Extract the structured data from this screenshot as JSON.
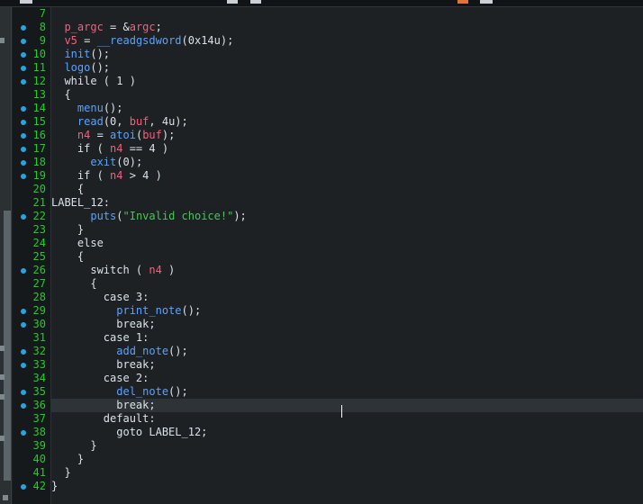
{
  "editor": {
    "lines": [
      {
        "n": "7",
        "bp": false,
        "code": ""
      },
      {
        "n": "8",
        "bp": true,
        "code": "  p_argc = &argc;"
      },
      {
        "n": "9",
        "bp": true,
        "code": "  v5 = __readgsdword(0x14u);"
      },
      {
        "n": "10",
        "bp": true,
        "code": "  init();"
      },
      {
        "n": "11",
        "bp": true,
        "code": "  logo();"
      },
      {
        "n": "12",
        "bp": true,
        "code": "  while ( 1 )"
      },
      {
        "n": "13",
        "bp": false,
        "code": "  {"
      },
      {
        "n": "14",
        "bp": true,
        "code": "    menu();"
      },
      {
        "n": "15",
        "bp": true,
        "code": "    read(0, buf, 4u);"
      },
      {
        "n": "16",
        "bp": true,
        "code": "    n4 = atoi(buf);"
      },
      {
        "n": "17",
        "bp": true,
        "code": "    if ( n4 == 4 )"
      },
      {
        "n": "18",
        "bp": true,
        "code": "      exit(0);"
      },
      {
        "n": "19",
        "bp": true,
        "code": "    if ( n4 > 4 )"
      },
      {
        "n": "20",
        "bp": false,
        "code": "    {"
      },
      {
        "n": "21",
        "bp": false,
        "code": "LABEL_12:"
      },
      {
        "n": "22",
        "bp": true,
        "code": "      puts(\"Invalid choice!\");"
      },
      {
        "n": "23",
        "bp": false,
        "code": "    }"
      },
      {
        "n": "24",
        "bp": false,
        "code": "    else"
      },
      {
        "n": "25",
        "bp": false,
        "code": "    {"
      },
      {
        "n": "26",
        "bp": true,
        "code": "      switch ( n4 )"
      },
      {
        "n": "27",
        "bp": false,
        "code": "      {"
      },
      {
        "n": "28",
        "bp": false,
        "code": "        case 3:"
      },
      {
        "n": "29",
        "bp": true,
        "code": "          print_note();"
      },
      {
        "n": "30",
        "bp": true,
        "code": "          break;"
      },
      {
        "n": "31",
        "bp": false,
        "code": "        case 1:"
      },
      {
        "n": "32",
        "bp": true,
        "code": "          add_note();"
      },
      {
        "n": "33",
        "bp": true,
        "code": "          break;"
      },
      {
        "n": "34",
        "bp": false,
        "code": "        case 2:"
      },
      {
        "n": "35",
        "bp": true,
        "code": "          del_note();"
      },
      {
        "n": "36",
        "bp": true,
        "code": "          break;"
      },
      {
        "n": "37",
        "bp": false,
        "code": "        default:"
      },
      {
        "n": "38",
        "bp": true,
        "code": "          goto LABEL_12;"
      },
      {
        "n": "39",
        "bp": false,
        "code": "      }"
      },
      {
        "n": "40",
        "bp": false,
        "code": "    }"
      },
      {
        "n": "41",
        "bp": false,
        "code": "  }"
      },
      {
        "n": "42",
        "bp": true,
        "code": "}"
      }
    ],
    "current_line": "36",
    "colors": {
      "background": "#1d2124",
      "line_number": "#19d21f",
      "breakpoint_dot": "#27a5df",
      "function": "#5aa2ff",
      "variable": "#ff5a7a",
      "string": "#49c45a",
      "text": "#d9e2e6"
    }
  }
}
